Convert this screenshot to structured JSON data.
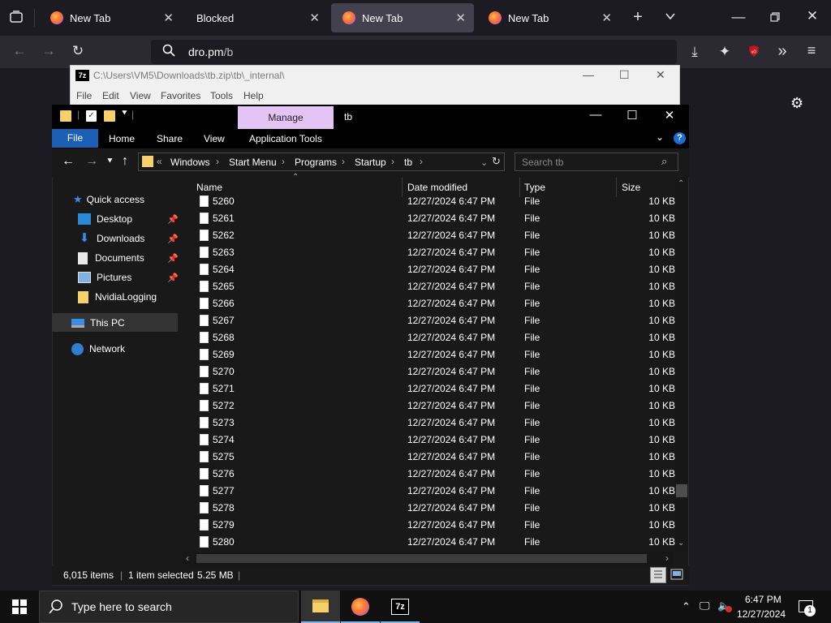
{
  "browser": {
    "tabs": [
      {
        "label": "New Tab",
        "active": false
      },
      {
        "label": "Blocked",
        "active": false
      },
      {
        "label": "New Tab",
        "active": true
      },
      {
        "label": "New Tab",
        "active": false
      }
    ],
    "url_host": "dro.pm",
    "url_path": "/b"
  },
  "sevenzip": {
    "logo": "7z",
    "title": "C:\\Users\\VM5\\Downloads\\tb.zip\\tb\\_internal\\",
    "menu": [
      "File",
      "Edit",
      "View",
      "Favorites",
      "Tools",
      "Help"
    ]
  },
  "explorer": {
    "title": "tb",
    "manage_label": "Manage",
    "ribbon_tabs": [
      "File",
      "Home",
      "Share",
      "View",
      "Application Tools"
    ],
    "breadcrumb": [
      "Windows",
      "Start Menu",
      "Programs",
      "Startup",
      "tb"
    ],
    "search_placeholder": "Search tb",
    "nav": {
      "quick_access": "Quick access",
      "items": [
        "Desktop",
        "Downloads",
        "Documents",
        "Pictures",
        "NvidiaLogging"
      ],
      "this_pc": "This PC",
      "network": "Network"
    },
    "columns": [
      "Name",
      "Date modified",
      "Type",
      "Size"
    ],
    "files": [
      {
        "name": "5260",
        "date": "12/27/2024 6:47 PM",
        "type": "File",
        "size": "10 KB"
      },
      {
        "name": "5261",
        "date": "12/27/2024 6:47 PM",
        "type": "File",
        "size": "10 KB"
      },
      {
        "name": "5262",
        "date": "12/27/2024 6:47 PM",
        "type": "File",
        "size": "10 KB"
      },
      {
        "name": "5263",
        "date": "12/27/2024 6:47 PM",
        "type": "File",
        "size": "10 KB"
      },
      {
        "name": "5264",
        "date": "12/27/2024 6:47 PM",
        "type": "File",
        "size": "10 KB"
      },
      {
        "name": "5265",
        "date": "12/27/2024 6:47 PM",
        "type": "File",
        "size": "10 KB"
      },
      {
        "name": "5266",
        "date": "12/27/2024 6:47 PM",
        "type": "File",
        "size": "10 KB"
      },
      {
        "name": "5267",
        "date": "12/27/2024 6:47 PM",
        "type": "File",
        "size": "10 KB"
      },
      {
        "name": "5268",
        "date": "12/27/2024 6:47 PM",
        "type": "File",
        "size": "10 KB"
      },
      {
        "name": "5269",
        "date": "12/27/2024 6:47 PM",
        "type": "File",
        "size": "10 KB"
      },
      {
        "name": "5270",
        "date": "12/27/2024 6:47 PM",
        "type": "File",
        "size": "10 KB"
      },
      {
        "name": "5271",
        "date": "12/27/2024 6:47 PM",
        "type": "File",
        "size": "10 KB"
      },
      {
        "name": "5272",
        "date": "12/27/2024 6:47 PM",
        "type": "File",
        "size": "10 KB"
      },
      {
        "name": "5273",
        "date": "12/27/2024 6:47 PM",
        "type": "File",
        "size": "10 KB"
      },
      {
        "name": "5274",
        "date": "12/27/2024 6:47 PM",
        "type": "File",
        "size": "10 KB"
      },
      {
        "name": "5275",
        "date": "12/27/2024 6:47 PM",
        "type": "File",
        "size": "10 KB"
      },
      {
        "name": "5276",
        "date": "12/27/2024 6:47 PM",
        "type": "File",
        "size": "10 KB"
      },
      {
        "name": "5277",
        "date": "12/27/2024 6:47 PM",
        "type": "File",
        "size": "10 KB"
      },
      {
        "name": "5278",
        "date": "12/27/2024 6:47 PM",
        "type": "File",
        "size": "10 KB"
      },
      {
        "name": "5279",
        "date": "12/27/2024 6:47 PM",
        "type": "File",
        "size": "10 KB"
      },
      {
        "name": "5280",
        "date": "12/27/2024 6:47 PM",
        "type": "File",
        "size": "10 KB"
      }
    ],
    "status": {
      "count": "6,015 items",
      "selected": "1 item selected",
      "size": "5.25 MB"
    }
  },
  "taskbar": {
    "search_text": "Type here to search",
    "time": "6:47 PM",
    "date": "12/27/2024",
    "notification_count": "1"
  },
  "colors": {
    "manage_tab": "#e4c4f4",
    "file_tab": "#1a5fb4",
    "folder": "#f5d06b"
  }
}
